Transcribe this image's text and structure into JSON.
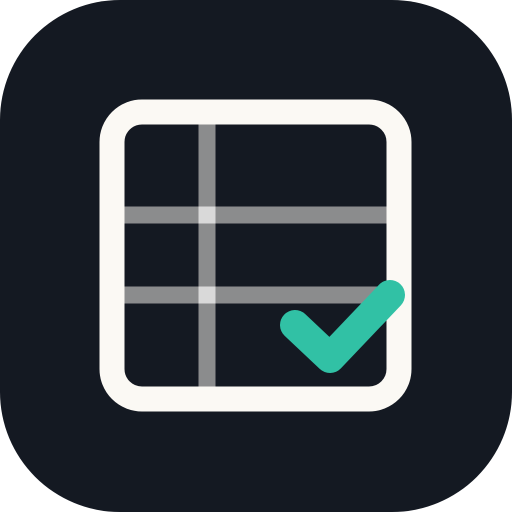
{
  "icon": {
    "name": "spreadsheet-check-icon",
    "colors": {
      "background": "#141922",
      "frame": "#fbf9f4",
      "grid_line": "#8b8c8d",
      "grid_intersection": "#d9d9d9",
      "check": "#31c1a5"
    }
  }
}
